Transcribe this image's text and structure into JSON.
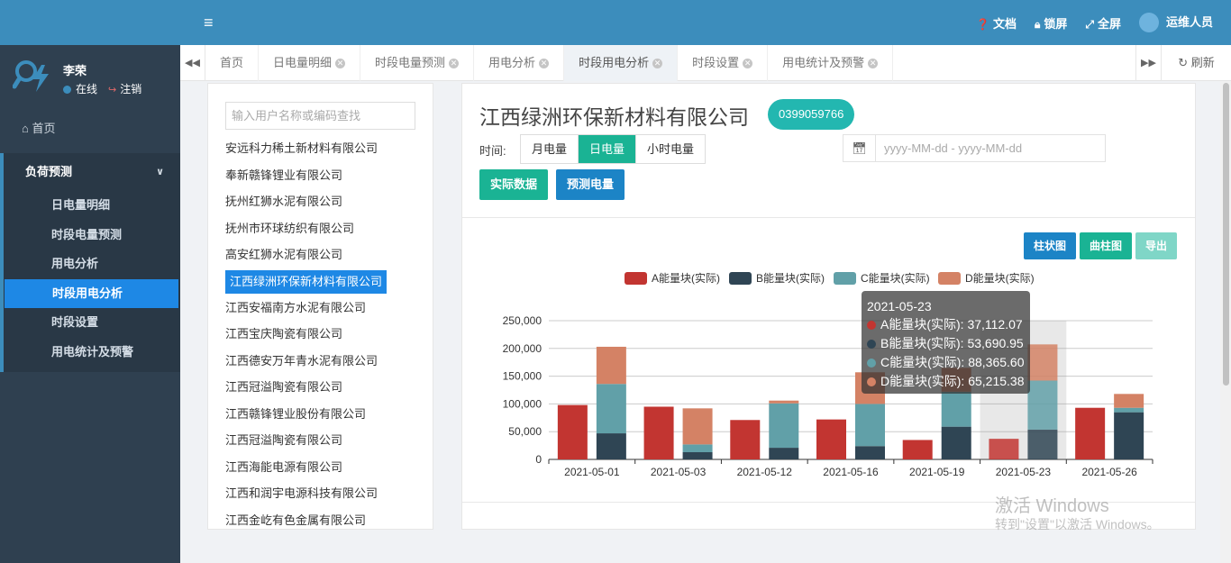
{
  "sidebar": {
    "user": {
      "name": "李荣",
      "status": "在线",
      "logout": "注销"
    },
    "home": "首页",
    "group": {
      "label": "负荷预测",
      "chevron": "chevron-down-icon"
    },
    "items": [
      "日电量明细",
      "时段电量预测",
      "用电分析",
      "时段用电分析",
      "时段设置",
      "用电统计及预警"
    ],
    "active_index": 3
  },
  "topbar": {
    "menu_icon": "hamburger-icon",
    "docs": "文档",
    "lock": "锁屏",
    "fullscreen": "全屏",
    "user": "运维人员"
  },
  "tabs": {
    "items": [
      {
        "label": "首页",
        "closable": false
      },
      {
        "label": "日电量明细",
        "closable": true
      },
      {
        "label": "时段电量预测",
        "closable": true
      },
      {
        "label": "用电分析",
        "closable": true
      },
      {
        "label": "时段用电分析",
        "closable": true,
        "active": true
      },
      {
        "label": "时段设置",
        "closable": true
      },
      {
        "label": "用电统计及预警",
        "closable": true
      }
    ],
    "refresh": "刷新"
  },
  "company_list": {
    "search_placeholder": "输入用户名称或编码查找",
    "items": [
      "安远科力稀土新材料有限公司",
      "奉新赣锋锂业有限公司",
      "抚州红狮水泥有限公司",
      "抚州市环球纺织有限公司",
      "高安红狮水泥有限公司",
      "江西绿洲环保新材料有限公司",
      "江西安福南方水泥有限公司",
      "江西宝庆陶瓷有限公司",
      "江西德安万年青水泥有限公司",
      "江西冠溢陶瓷有限公司",
      "江西赣锋锂业股份有限公司",
      "江西冠溢陶瓷有限公司",
      "江西海能电源有限公司",
      "江西和润宇电源科技有限公司",
      "江西金屹有色金属有限公司"
    ],
    "active_index": 5
  },
  "main": {
    "company_title": "江西绿洲环保新材料有限公司",
    "phone": "0399059766",
    "time_label": "时间:",
    "period_buttons": [
      "月电量",
      "日电量",
      "小时电量"
    ],
    "active_period": 1,
    "date_placeholder": "yyyy-MM-dd - yyyy-MM-dd",
    "btn_actual": "实际数据",
    "btn_predict": "预测电量",
    "btn_bar": "柱状图",
    "btn_line": "曲柱图",
    "btn_export": "导出"
  },
  "tooltip": {
    "title": "2021-05-23",
    "rows": [
      {
        "label": "A能量块(实际): 37,112.07",
        "color": "#c23531"
      },
      {
        "label": "B能量块(实际): 53,690.95",
        "color": "#2f4554"
      },
      {
        "label": "C能量块(实际): 88,365.60",
        "color": "#61a0a8"
      },
      {
        "label": "D能量块(实际): 65,215.38",
        "color": "#d48265"
      }
    ]
  },
  "chart_data": {
    "type": "bar",
    "stacked": true,
    "categories": [
      "2021-05-01",
      "2021-05-03",
      "2021-05-12",
      "2021-05-16",
      "2021-05-19",
      "2021-05-23",
      "2021-05-26"
    ],
    "ylim": [
      0,
      250000
    ],
    "yticks": [
      "0",
      "50,000",
      "100,000",
      "150,000",
      "200,000",
      "250,000"
    ],
    "legend_position": "top",
    "highlighted_category": "2021-05-23",
    "groups": [
      {
        "category": "2021-05-01",
        "bars": [
          {
            "segments": [
              {
                "series": "A能量块(实际)",
                "value": 98000
              }
            ]
          },
          {
            "segments": [
              {
                "series": "B能量块(实际)",
                "value": 47000
              },
              {
                "series": "C能量块(实际)",
                "value": 89000
              },
              {
                "series": "D能量块(实际)",
                "value": 67000
              }
            ]
          }
        ]
      },
      {
        "category": "2021-05-03",
        "bars": [
          {
            "segments": [
              {
                "series": "A能量块(实际)",
                "value": 95000
              }
            ]
          },
          {
            "segments": [
              {
                "series": "B能量块(实际)",
                "value": 13000
              },
              {
                "series": "C能量块(实际)",
                "value": 14000
              },
              {
                "series": "D能量块(实际)",
                "value": 65000
              }
            ]
          }
        ]
      },
      {
        "category": "2021-05-12",
        "bars": [
          {
            "segments": [
              {
                "series": "A能量块(实际)",
                "value": 71000
              }
            ]
          },
          {
            "segments": [
              {
                "series": "B能量块(实际)",
                "value": 21000
              },
              {
                "series": "C能量块(实际)",
                "value": 80000
              },
              {
                "series": "D能量块(实际)",
                "value": 5000
              }
            ]
          }
        ]
      },
      {
        "category": "2021-05-16",
        "bars": [
          {
            "segments": [
              {
                "series": "A能量块(实际)",
                "value": 72000
              }
            ]
          },
          {
            "segments": [
              {
                "series": "B能量块(实际)",
                "value": 24000
              },
              {
                "series": "C能量块(实际)",
                "value": 76000
              },
              {
                "series": "D能量块(实际)",
                "value": 57000
              }
            ]
          }
        ]
      },
      {
        "category": "2021-05-19",
        "bars": [
          {
            "segments": [
              {
                "series": "A能量块(实际)",
                "value": 35000
              }
            ]
          },
          {
            "segments": [
              {
                "series": "B能量块(实际)",
                "value": 59000
              },
              {
                "series": "C能量块(实际)",
                "value": 63000
              },
              {
                "series": "D能量块(实际)",
                "value": 43000
              }
            ]
          }
        ]
      },
      {
        "category": "2021-05-23",
        "bars": [
          {
            "segments": [
              {
                "series": "A能量块(实际)",
                "value": 37112.07
              }
            ]
          },
          {
            "segments": [
              {
                "series": "B能量块(实际)",
                "value": 53690.95
              },
              {
                "series": "C能量块(实际)",
                "value": 88365.6
              },
              {
                "series": "D能量块(实际)",
                "value": 65215.38
              }
            ]
          }
        ]
      },
      {
        "category": "2021-05-26",
        "bars": [
          {
            "segments": [
              {
                "series": "A能量块(实际)",
                "value": 93000
              }
            ]
          },
          {
            "segments": [
              {
                "series": "B能量块(实际)",
                "value": 85000
              },
              {
                "series": "C能量块(实际)",
                "value": 8000
              },
              {
                "series": "D能量块(实际)",
                "value": 25000
              }
            ]
          }
        ]
      }
    ],
    "series": [
      {
        "name": "A能量块(实际)",
        "color": "#c23531"
      },
      {
        "name": "B能量块(实际)",
        "color": "#2f4554"
      },
      {
        "name": "C能量块(实际)",
        "color": "#61a0a8"
      },
      {
        "name": "D能量块(实际)",
        "color": "#d48265"
      }
    ]
  },
  "watermark": {
    "line1": "激活 Windows",
    "line2": "转到\"设置\"以激活 Windows。"
  }
}
